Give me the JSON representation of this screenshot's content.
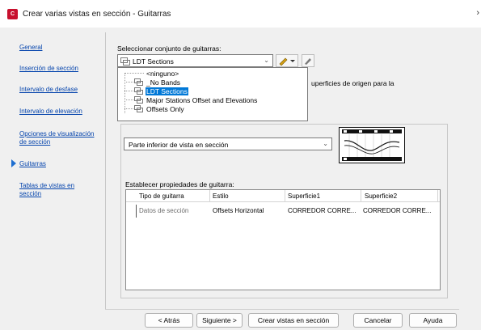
{
  "window": {
    "title": "Crear varias vistas en sección - Guitarras",
    "app_icon": "autocad-civil-icon",
    "close_glyph": "›"
  },
  "nav": {
    "items": [
      {
        "label": "General"
      },
      {
        "label": "Inserción de sección"
      },
      {
        "label": "Intervalo de desfase"
      },
      {
        "label": "Intervalo de elevación"
      },
      {
        "label": "Opciones de visualización de sección"
      },
      {
        "label": "Guitarras"
      },
      {
        "label": "Tablas de vistas en sección"
      }
    ],
    "current": "Guitarras"
  },
  "band_set": {
    "label": "Seleccionar conjunto de guitarras:",
    "value": "LDT Sections",
    "options": [
      {
        "label": "<ninguno>"
      },
      {
        "label": "_No Bands"
      },
      {
        "label": "LDT Sections"
      },
      {
        "label": "Major Stations Offset and Elevations"
      },
      {
        "label": "Offsets Only"
      }
    ],
    "selected_index": 2
  },
  "surfaces_partial_text": "uperficies de origen para la",
  "location": {
    "value": "Parte inferior de vista en sección"
  },
  "properties": {
    "label": "Establecer propiedades de guitarra:",
    "columns": [
      "Tipo de guitarra",
      "Estilo",
      "Superficie1",
      "Superficie2"
    ],
    "rows": [
      [
        "Datos de sección",
        "Offsets Horizontal",
        "CORREDOR CORRE...",
        "CORREDOR CORRE..."
      ]
    ]
  },
  "buttons": {
    "back": "< Atrás",
    "next": "Siguiente >",
    "create": "Crear vistas en sección",
    "cancel": "Cancelar",
    "help": "Ayuda"
  },
  "colors": {
    "link": "#0645ad",
    "selection": "#0078d7",
    "app_icon": "#c8102e"
  }
}
